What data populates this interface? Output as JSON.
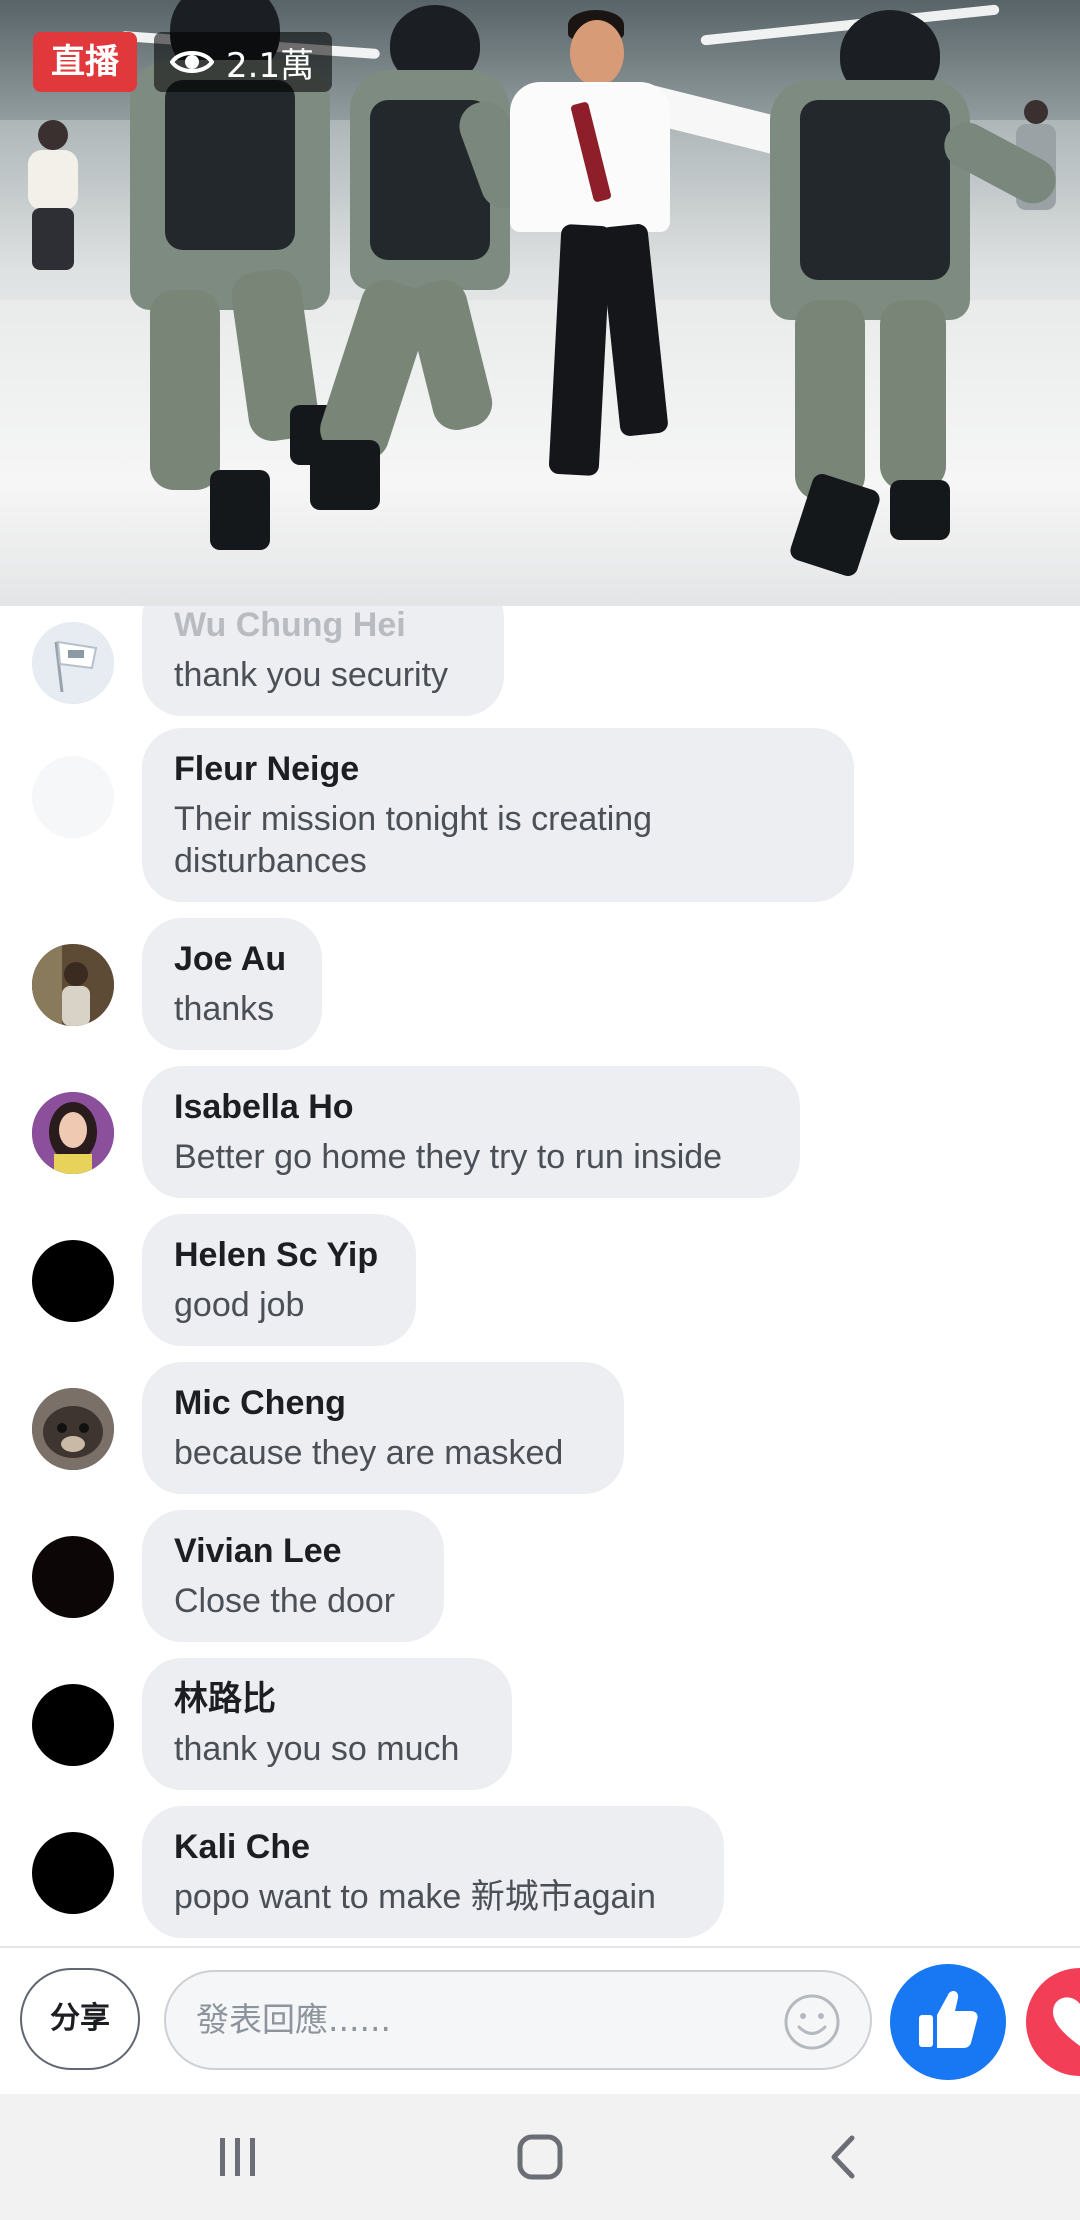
{
  "video": {
    "live_label": "直播",
    "viewer_count": "2.1萬",
    "eye_icon": "eye-icon"
  },
  "comments": [
    {
      "name": "Wu Chung Hei",
      "text": "thank you security",
      "avatar": "flag-avatar"
    },
    {
      "name": "Fleur Neige",
      "text": "Their mission tonight is creating disturbances",
      "avatar": "white-avatar"
    },
    {
      "name": "Joe Au",
      "text": "thanks",
      "avatar": "photo-avatar"
    },
    {
      "name": "Isabella Ho",
      "text": "Better go home they try to run inside",
      "avatar": "photo-avatar"
    },
    {
      "name": "Helen Sc Yip",
      "text": "good job",
      "avatar": "black-avatar"
    },
    {
      "name": "Mic Cheng",
      "text": "because they are masked",
      "avatar": "photo-avatar"
    },
    {
      "name": "Vivian Lee",
      "text": "Close the door",
      "avatar": "black-avatar"
    },
    {
      "name": "林路比",
      "text": "thank you so much",
      "avatar": "black-avatar"
    },
    {
      "name": "Kali Che",
      "text": "popo want to make 新城市again",
      "avatar": "black-avatar"
    }
  ],
  "bottom_bar": {
    "share_label": "分享",
    "comment_placeholder": "發表回應......",
    "emoji_icon": "smiley-icon",
    "like_icon": "thumbs-up-icon",
    "love_icon": "heart-icon"
  },
  "system_nav": {
    "recents_icon": "recent-apps-icon",
    "home_icon": "home-icon",
    "back_icon": "back-icon"
  },
  "colors": {
    "live_red": "#e0383b",
    "bubble_bg": "#eceef1",
    "like_blue": "#1877f2",
    "love_red": "#f33e58"
  }
}
